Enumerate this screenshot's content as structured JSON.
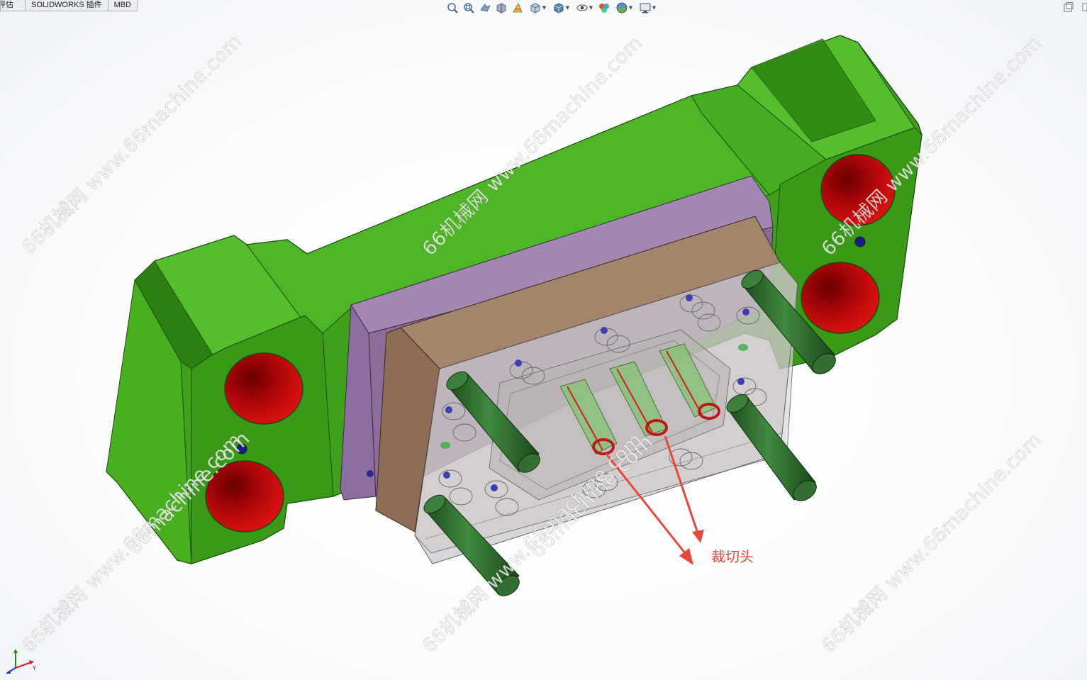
{
  "tabs": [
    "评估",
    "SOLIDWORKS 插件",
    "MBD"
  ],
  "hud_toolbar": {
    "icons": [
      "zoom-to-fit-icon",
      "zoom-area-icon",
      "previous-view-icon",
      "section-view-icon",
      "dynamic-annotation-icon",
      "view-orientation-icon",
      "display-style-icon",
      "hide-show-icon",
      "edit-appearance-icon",
      "apply-scene-icon",
      "view-settings-icon"
    ]
  },
  "watermark": "66机械网 www.66machine.com",
  "watermark_center": "66machine.com",
  "callout": {
    "label": "裁切头",
    "color": "#e8483c"
  },
  "colors": {
    "clamp_plate": "#3ea01a",
    "plate_purple": "#8c6f98",
    "plate_brown": "#9a7d68",
    "guide_pin": "#2c6b2c",
    "hole": "#c4090c"
  }
}
